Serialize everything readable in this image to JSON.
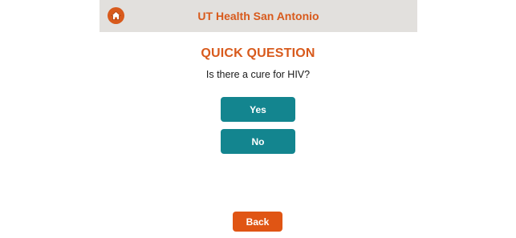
{
  "header": {
    "title": "UT Health San Antonio",
    "home_icon": "home-icon"
  },
  "question": {
    "heading": "QUICK QUESTION",
    "text": "Is there a cure for HIV?"
  },
  "answers": [
    {
      "label": "Yes"
    },
    {
      "label": "No"
    }
  ],
  "footer": {
    "back_label": "Back"
  },
  "colors": {
    "brand_orange": "#d85a1c",
    "teal": "#13858f",
    "header_bg": "#e2e0dd"
  }
}
